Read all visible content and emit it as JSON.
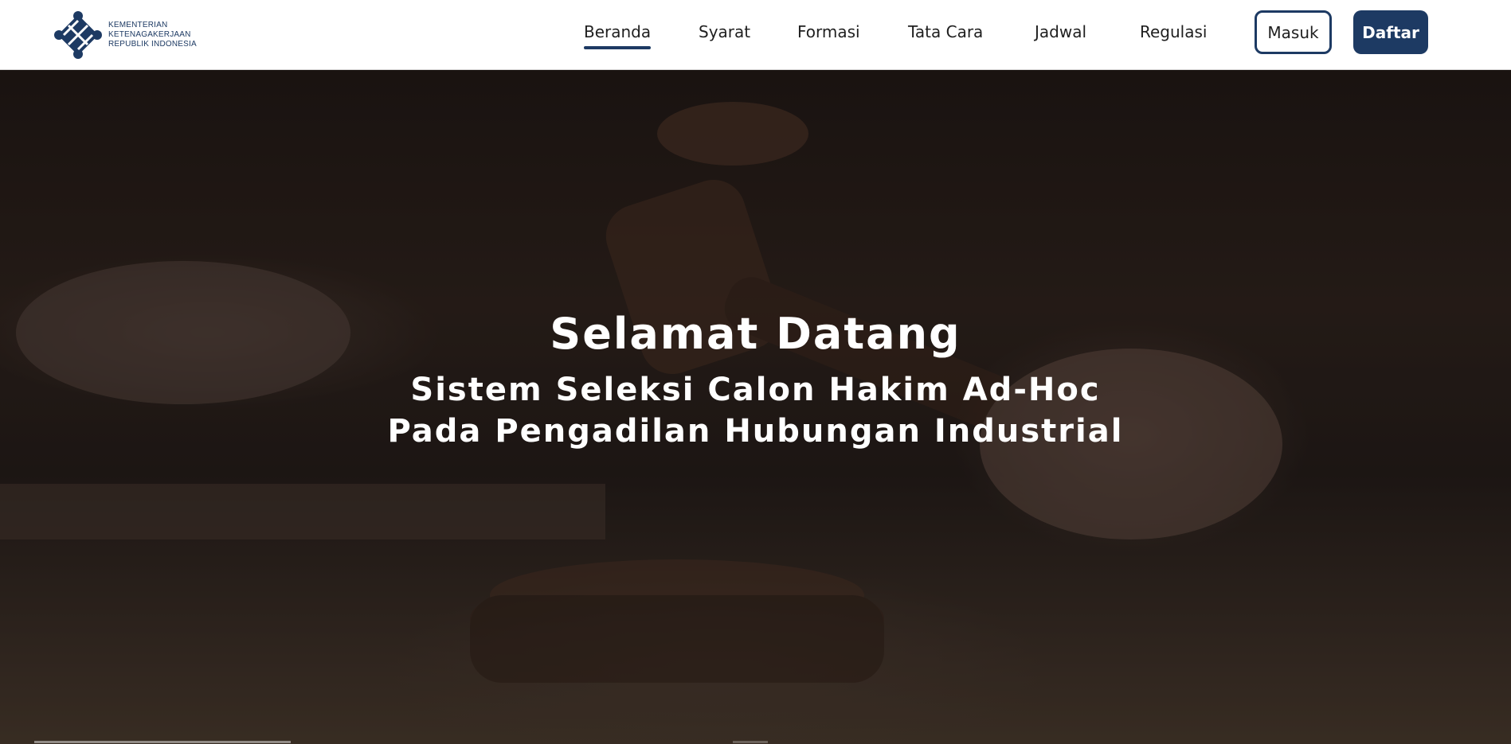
{
  "header": {
    "logo": {
      "icon": "kemnaker-logo-icon",
      "lines": [
        "KEMENTERIAN",
        "KETENAGAKERJAAN",
        "REPUBLIK INDONESIA"
      ]
    },
    "nav": [
      {
        "label": "Beranda",
        "active": true
      },
      {
        "label": "Syarat",
        "active": false
      },
      {
        "label": "Formasi",
        "active": false
      },
      {
        "label": "Tata Cara",
        "active": false
      },
      {
        "label": "Jadwal",
        "active": false
      },
      {
        "label": "Regulasi",
        "active": false
      }
    ],
    "login_label": "Masuk",
    "register_label": "Daftar"
  },
  "hero": {
    "title": "Selamat Datang",
    "subtitle_line1": "Sistem Seleksi Calon Hakim Ad-Hoc",
    "subtitle_line2": "Pada Pengadilan Hubungan Industrial",
    "background_image": "judge-gavel-photo"
  },
  "colors": {
    "brand": "#1d3a63",
    "text": "#1f1f1f",
    "hero_text": "#ffffff"
  }
}
